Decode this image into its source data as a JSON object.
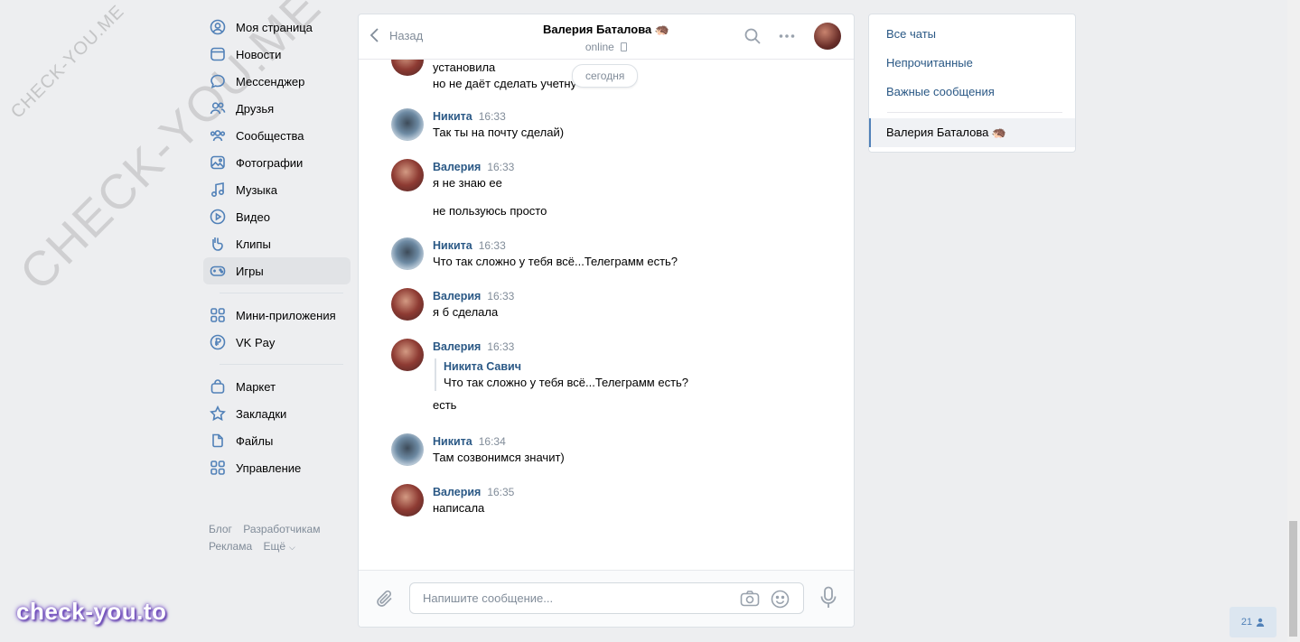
{
  "watermark": {
    "small": "CHECK-YOU.ME",
    "big": "CHECK-YOU.ME",
    "logo": "check-you.to"
  },
  "leftnav": {
    "items": [
      {
        "label": "Моя страница",
        "icon": "user-circle-icon"
      },
      {
        "label": "Новости",
        "icon": "newspaper-icon"
      },
      {
        "label": "Мессенджер",
        "icon": "chat-bubble-icon"
      },
      {
        "label": "Друзья",
        "icon": "friends-icon"
      },
      {
        "label": "Сообщества",
        "icon": "communities-icon"
      },
      {
        "label": "Фотографии",
        "icon": "photo-icon"
      },
      {
        "label": "Музыка",
        "icon": "music-note-icon"
      },
      {
        "label": "Видео",
        "icon": "play-circle-icon"
      },
      {
        "label": "Клипы",
        "icon": "clips-icon"
      },
      {
        "label": "Игры",
        "icon": "gamepad-icon",
        "active": true
      }
    ],
    "items2": [
      {
        "label": "Мини-приложения",
        "icon": "grid-icon"
      },
      {
        "label": "VK Pay",
        "icon": "ruble-icon"
      }
    ],
    "items3": [
      {
        "label": "Маркет",
        "icon": "bag-icon"
      },
      {
        "label": "Закладки",
        "icon": "star-icon"
      },
      {
        "label": "Файлы",
        "icon": "file-icon"
      },
      {
        "label": "Управление",
        "icon": "grid-icon"
      }
    ],
    "footer": {
      "blog": "Блог",
      "developers": "Разработчикам",
      "ads": "Реклама",
      "more": "Ещё"
    }
  },
  "chat": {
    "back_label": "Назад",
    "peer_name": "Валерия Баталова 🦔",
    "peer_status": "online",
    "date_label": "сегодня",
    "partial": {
      "line1": "установила",
      "line2": "но не даёт сделать учетну"
    },
    "messages": [
      {
        "author": "Никита",
        "time": "16:33",
        "texts": [
          "Так ты на почту сделай)"
        ],
        "who": "nikita"
      },
      {
        "author": "Валерия",
        "time": "16:33",
        "texts": [
          "я не знаю ее",
          "не пользуюсь просто"
        ],
        "who": "valeria"
      },
      {
        "author": "Никита",
        "time": "16:33",
        "texts": [
          "Что так сложно у тебя всё...Телеграмм есть?"
        ],
        "who": "nikita"
      },
      {
        "author": "Валерия",
        "time": "16:33",
        "texts": [
          "я б сделала"
        ],
        "who": "valeria"
      },
      {
        "author": "Валерия",
        "time": "16:33",
        "reply": {
          "author": "Никита Савич",
          "text": "Что так сложно у тебя всё...Телеграмм есть?"
        },
        "texts": [
          "есть"
        ],
        "who": "valeria"
      },
      {
        "author": "Никита",
        "time": "16:34",
        "texts": [
          "Там созвонимся значит)"
        ],
        "who": "nikita"
      },
      {
        "author": "Валерия",
        "time": "16:35",
        "texts": [
          "написала"
        ],
        "who": "valeria"
      }
    ],
    "composer": {
      "placeholder": "Напишите сообщение..."
    }
  },
  "rightpanel": {
    "all_chats": "Все чаты",
    "unread": "Непрочитанные",
    "important": "Важные сообщения",
    "active_chat": "Валерия Баталова 🦔"
  },
  "counter": "21"
}
